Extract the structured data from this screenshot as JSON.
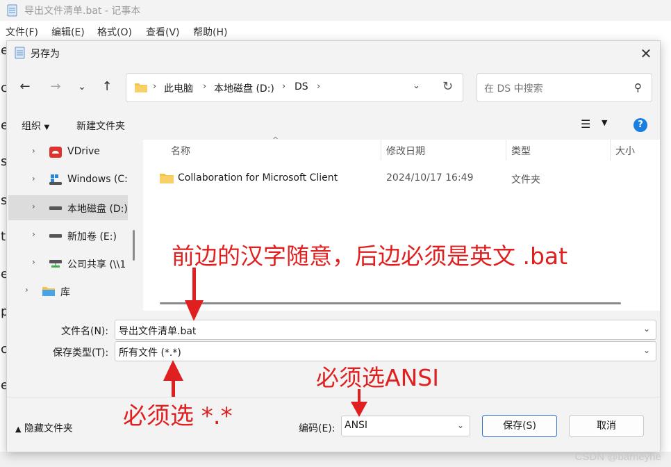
{
  "notepad": {
    "title": "导出文件清单.bat - 记事本",
    "menu": [
      "文件(F)",
      "编辑(E)",
      "格式(O)",
      "查看(V)",
      "帮助(H)"
    ],
    "left_chars": [
      "e",
      "c",
      "e",
      "s",
      "s",
      "t",
      "e",
      "p",
      "c",
      "e"
    ]
  },
  "dialog": {
    "title": "另存为",
    "breadcrumbs": [
      "此电脑",
      "本地磁盘 (D:)",
      "DS"
    ],
    "search_placeholder": "在 DS 中搜索",
    "toolbar": {
      "organize": "组织",
      "new_folder": "新建文件夹"
    },
    "nav_items": [
      {
        "label": "VDrive",
        "icon": "vdrive-icon"
      },
      {
        "label": "Windows (C:)",
        "icon": "windows-drive-icon"
      },
      {
        "label": "本地磁盘 (D:)",
        "icon": "drive-icon",
        "selected": true
      },
      {
        "label": "新加卷 (E:)",
        "icon": "drive-icon"
      },
      {
        "label": "公司共享 (\\\\1",
        "icon": "network-drive-icon"
      },
      {
        "label": "库",
        "icon": "library-icon"
      }
    ],
    "columns": [
      "名称",
      "修改日期",
      "类型",
      "大小"
    ],
    "files": [
      {
        "name": "Collaboration for Microsoft Client",
        "modified": "2024/10/17 16:49",
        "type": "文件夹"
      }
    ],
    "filename_label": "文件名(N):",
    "filename_value": "导出文件清单.bat",
    "filetype_label": "保存类型(T):",
    "filetype_value": "所有文件  (*.*)",
    "hide_folders": "隐藏文件夹",
    "encoding_label": "编码(E):",
    "encoding_value": "ANSI",
    "save_button": "保存(S)",
    "cancel_button": "取消"
  },
  "annotations": {
    "filename_note": "前边的汉字随意，后边必须是英文  .bat",
    "filetype_note": "必须选 *.*",
    "encoding_note": "必须选ANSI"
  },
  "watermark": "CSDN @barneyhe",
  "colors": {
    "accent": "#1a7ee0",
    "annotation": "#e02020",
    "folder": "#f6c244"
  }
}
